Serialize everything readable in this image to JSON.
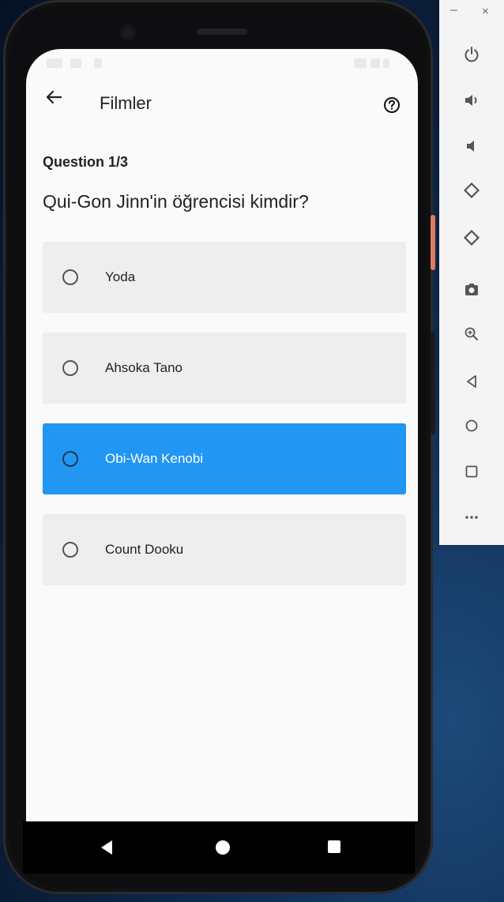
{
  "app": {
    "title": "Filmler",
    "back_icon": "arrow-back-icon",
    "help_icon": "help-circle-icon"
  },
  "quiz": {
    "question_number": "Question 1/3",
    "question_text": "Qui-Gon Jinn'in öğrencisi kimdir?",
    "options": [
      {
        "label": "Yoda",
        "selected": false
      },
      {
        "label": "Ahsoka Tano",
        "selected": false
      },
      {
        "label": "Obi-Wan Kenobi",
        "selected": true
      },
      {
        "label": "Count Dooku",
        "selected": false
      }
    ]
  },
  "navbar": {
    "icons": [
      "nav-back-icon",
      "nav-home-icon",
      "nav-recents-icon"
    ]
  },
  "emulator_panel": {
    "window_controls": {
      "minimize": "–",
      "close": "×"
    },
    "tools": [
      "power-icon",
      "volume-up-icon",
      "volume-down-icon",
      "rotate-left-icon",
      "rotate-right-icon",
      "camera-icon",
      "zoom-icon",
      "back-icon",
      "home-icon",
      "overview-icon",
      "more-icon"
    ]
  },
  "colors": {
    "selected_option": "#2196f3",
    "option_background": "#eeeeee",
    "screen_background": "#fafafa"
  }
}
